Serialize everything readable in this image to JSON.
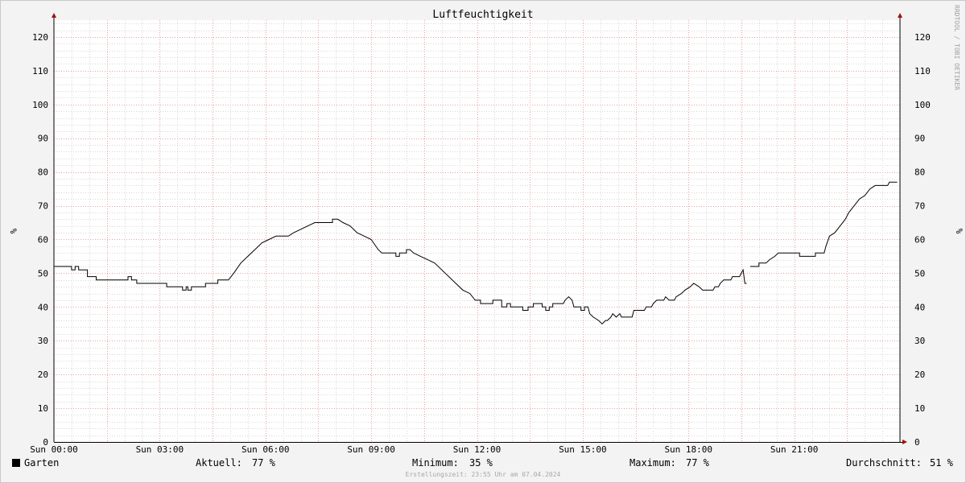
{
  "chart_data": {
    "type": "line",
    "title": "Luftfeuchtigkeit",
    "ylabel": "%",
    "ylabel_right": "%",
    "ylim": [
      0,
      125
    ],
    "y_ticks": [
      0,
      10,
      20,
      30,
      40,
      50,
      60,
      70,
      80,
      90,
      100,
      110,
      120
    ],
    "x_ticks": [
      "Sun 00:00",
      "Sun 03:00",
      "Sun 06:00",
      "Sun 09:00",
      "Sun 12:00",
      "Sun 15:00",
      "Sun 18:00",
      "Sun 21:00"
    ],
    "grid": true,
    "series": [
      {
        "name": "Garten",
        "color": "#000000",
        "points": [
          [
            0.0,
            52
          ],
          [
            0.5,
            52
          ],
          [
            0.5,
            51
          ],
          [
            0.6,
            51
          ],
          [
            0.6,
            52
          ],
          [
            0.7,
            52
          ],
          [
            0.7,
            51
          ],
          [
            0.95,
            51
          ],
          [
            0.95,
            49
          ],
          [
            1.2,
            49
          ],
          [
            1.2,
            48
          ],
          [
            2.1,
            48
          ],
          [
            2.1,
            49
          ],
          [
            2.2,
            49
          ],
          [
            2.2,
            48
          ],
          [
            2.35,
            48
          ],
          [
            2.35,
            47
          ],
          [
            3.2,
            47
          ],
          [
            3.2,
            46
          ],
          [
            3.65,
            46
          ],
          [
            3.65,
            45
          ],
          [
            3.75,
            45
          ],
          [
            3.75,
            46
          ],
          [
            3.8,
            46
          ],
          [
            3.8,
            45
          ],
          [
            3.9,
            45
          ],
          [
            3.9,
            46
          ],
          [
            4.3,
            46
          ],
          [
            4.3,
            47
          ],
          [
            4.65,
            47
          ],
          [
            4.65,
            48
          ],
          [
            4.95,
            48
          ],
          [
            5.1,
            50
          ],
          [
            5.3,
            53
          ],
          [
            5.5,
            55
          ],
          [
            5.7,
            57
          ],
          [
            5.9,
            59
          ],
          [
            6.1,
            60
          ],
          [
            6.3,
            61
          ],
          [
            6.65,
            61
          ],
          [
            6.8,
            62
          ],
          [
            7.0,
            63
          ],
          [
            7.2,
            64
          ],
          [
            7.4,
            65
          ],
          [
            7.9,
            65
          ],
          [
            7.9,
            66
          ],
          [
            8.05,
            66
          ],
          [
            8.2,
            65
          ],
          [
            8.4,
            64
          ],
          [
            8.6,
            62
          ],
          [
            8.8,
            61
          ],
          [
            9.0,
            60
          ],
          [
            9.2,
            57
          ],
          [
            9.3,
            56
          ],
          [
            9.7,
            56
          ],
          [
            9.7,
            55
          ],
          [
            9.8,
            55
          ],
          [
            9.8,
            56
          ],
          [
            10.0,
            56
          ],
          [
            10.0,
            57
          ],
          [
            10.1,
            57
          ],
          [
            10.2,
            56
          ],
          [
            10.4,
            55
          ],
          [
            10.6,
            54
          ],
          [
            10.8,
            53
          ],
          [
            11.0,
            51
          ],
          [
            11.2,
            49
          ],
          [
            11.4,
            47
          ],
          [
            11.6,
            45
          ],
          [
            11.8,
            44
          ],
          [
            11.95,
            42
          ],
          [
            12.1,
            42
          ],
          [
            12.1,
            41
          ],
          [
            12.45,
            41
          ],
          [
            12.45,
            42
          ],
          [
            12.7,
            42
          ],
          [
            12.7,
            40
          ],
          [
            12.85,
            40
          ],
          [
            12.85,
            41
          ],
          [
            12.95,
            41
          ],
          [
            12.95,
            40
          ],
          [
            13.3,
            40
          ],
          [
            13.3,
            39
          ],
          [
            13.45,
            39
          ],
          [
            13.45,
            40
          ],
          [
            13.6,
            40
          ],
          [
            13.6,
            41
          ],
          [
            13.85,
            41
          ],
          [
            13.85,
            40
          ],
          [
            13.95,
            40
          ],
          [
            13.95,
            39
          ],
          [
            14.05,
            39
          ],
          [
            14.05,
            40
          ],
          [
            14.15,
            40
          ],
          [
            14.15,
            41
          ],
          [
            14.45,
            41
          ],
          [
            14.5,
            42
          ],
          [
            14.6,
            43
          ],
          [
            14.7,
            42
          ],
          [
            14.75,
            40
          ],
          [
            14.95,
            40
          ],
          [
            14.95,
            39
          ],
          [
            15.05,
            39
          ],
          [
            15.05,
            40
          ],
          [
            15.15,
            40
          ],
          [
            15.2,
            38
          ],
          [
            15.3,
            37
          ],
          [
            15.45,
            36
          ],
          [
            15.55,
            35
          ],
          [
            15.65,
            36
          ],
          [
            15.7,
            36
          ],
          [
            15.8,
            37
          ],
          [
            15.85,
            38
          ],
          [
            15.95,
            37
          ],
          [
            16.05,
            38
          ],
          [
            16.1,
            37
          ],
          [
            16.4,
            37
          ],
          [
            16.45,
            39
          ],
          [
            16.75,
            39
          ],
          [
            16.8,
            40
          ],
          [
            16.95,
            40
          ],
          [
            17.0,
            41
          ],
          [
            17.1,
            42
          ],
          [
            17.3,
            42
          ],
          [
            17.35,
            43
          ],
          [
            17.45,
            42
          ],
          [
            17.6,
            42
          ],
          [
            17.65,
            43
          ],
          [
            17.8,
            44
          ],
          [
            17.9,
            45
          ],
          [
            18.05,
            46
          ],
          [
            18.15,
            47
          ],
          [
            18.3,
            46
          ],
          [
            18.4,
            45
          ],
          [
            18.7,
            45
          ],
          [
            18.75,
            46
          ],
          [
            18.85,
            46
          ],
          [
            18.9,
            47
          ],
          [
            19.0,
            48
          ],
          [
            19.2,
            48
          ],
          [
            19.25,
            49
          ],
          [
            19.45,
            49
          ],
          [
            19.5,
            50
          ],
          [
            19.55,
            51
          ],
          [
            19.6,
            47
          ],
          [
            19.65,
            47
          ],
          null,
          [
            19.75,
            52
          ],
          [
            20.0,
            52
          ],
          [
            20.0,
            53
          ],
          [
            20.2,
            53
          ],
          [
            20.3,
            54
          ],
          [
            20.45,
            55
          ],
          [
            20.55,
            56
          ],
          [
            21.15,
            56
          ],
          [
            21.15,
            55
          ],
          [
            21.6,
            55
          ],
          [
            21.6,
            56
          ],
          [
            21.85,
            56
          ],
          [
            21.9,
            58
          ],
          [
            22.0,
            61
          ],
          [
            22.15,
            62
          ],
          [
            22.3,
            64
          ],
          [
            22.45,
            66
          ],
          [
            22.55,
            68
          ],
          [
            22.7,
            70
          ],
          [
            22.85,
            72
          ],
          [
            23.0,
            73
          ],
          [
            23.15,
            75
          ],
          [
            23.3,
            76
          ],
          [
            23.65,
            76
          ],
          [
            23.7,
            77
          ],
          [
            23.92,
            77
          ]
        ]
      }
    ],
    "legend": [
      {
        "label": "Garten",
        "color": "#000000"
      }
    ],
    "stats": {
      "current_label": "Aktuell:",
      "current_value": "77 %",
      "min_label": "Minimum:",
      "min_value": "35 %",
      "max_label": "Maximum:",
      "max_value": "77 %",
      "avg_label": "Durchschnitt:",
      "avg_value": "51 %"
    }
  },
  "footer": {
    "credit": "Erstellungszeit: 23:55 Uhr am 07.04.2024",
    "vertical_credit": "RRDTOOL / TOBI OETIKER"
  }
}
